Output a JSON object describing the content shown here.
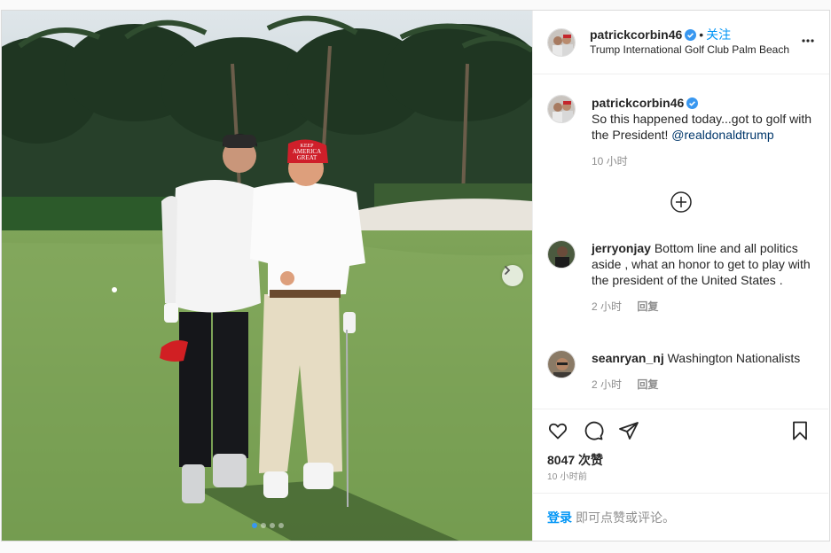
{
  "post": {
    "username": "patrickcorbin46",
    "separator": "•",
    "follow_label": "关注",
    "location": "Trump International Golf Club Palm Beach",
    "photo_count": 4,
    "active_photo_index": 0
  },
  "caption": {
    "username": "patrickcorbin46",
    "text": "So this happened today...got to golf with the President!",
    "mention": "@realdonaldtrump",
    "time": "10 小时"
  },
  "comments": [
    {
      "username": "jerryonjay",
      "text": "Bottom line and all politics aside , what an honor to get to play with the president of the United States .",
      "time": "2 小时",
      "reply_label": "回复"
    },
    {
      "username": "seanryan_nj",
      "text": "Washington Nationalists",
      "time": "2 小时",
      "reply_label": "回复"
    }
  ],
  "stats": {
    "likes": "8047 次赞",
    "timestamp": "10 小时前"
  },
  "login": {
    "link_label": "登录",
    "rest_text": "即可点赞或评论。"
  },
  "photo_text": {
    "hat_line1": "KEEP",
    "hat_line2": "AMERICA",
    "hat_line3": "GREAT"
  },
  "icons": {
    "verified": "verified-badge-icon",
    "more": "more-options-icon",
    "load_more": "load-more-comments-icon",
    "like": "heart-icon",
    "comment": "comment-icon",
    "share": "share-icon",
    "save": "bookmark-icon",
    "next": "chevron-right-icon"
  },
  "colors": {
    "accent": "#0095f6",
    "verified": "#3897f0",
    "mention": "#00376b",
    "muted": "#8e8e8e"
  }
}
